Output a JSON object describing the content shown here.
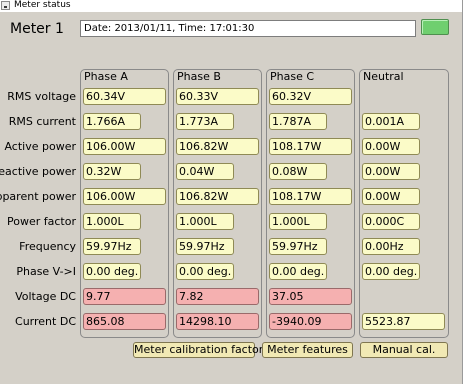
{
  "window": {
    "title": "Meter status"
  },
  "header": {
    "meter_label": "Meter 1",
    "datetime": "Date: 2013/01/11, Time: 17:01:30",
    "status_color": "#6fcf6f"
  },
  "table": {
    "columns": [
      "Phase A",
      "Phase B",
      "Phase C",
      "Neutral"
    ],
    "rows": [
      {
        "label": "RMS voltage",
        "values": [
          "60.34V",
          "60.33V",
          "60.32V",
          ""
        ]
      },
      {
        "label": "RMS current",
        "values": [
          "1.766A",
          "1.773A",
          "1.787A",
          "0.001A"
        ]
      },
      {
        "label": "Active power",
        "values": [
          "106.00W",
          "106.82W",
          "108.17W",
          "0.00W"
        ]
      },
      {
        "label": "Reactive power",
        "values": [
          "0.32W",
          "0.04W",
          "0.08W",
          "0.00W"
        ]
      },
      {
        "label": "Apparent power",
        "values": [
          "106.00W",
          "106.82W",
          "108.17W",
          "0.00W"
        ]
      },
      {
        "label": "Power factor",
        "values": [
          "1.000L",
          "1.000L",
          "1.000L",
          "0.000C"
        ]
      },
      {
        "label": "Frequency",
        "values": [
          "59.97Hz",
          "59.97Hz",
          "59.97Hz",
          "0.00Hz"
        ]
      },
      {
        "label": "Phase V->I",
        "values": [
          "0.00 deg.",
          "0.00 deg.",
          "0.00 deg.",
          "0.00 deg."
        ]
      },
      {
        "label": "Voltage DC",
        "values": [
          "9.77",
          "7.82",
          "37.05",
          ""
        ]
      },
      {
        "label": "Current DC",
        "values": [
          "865.08",
          "14298.10",
          "-3940.09",
          "5523.87"
        ]
      }
    ]
  },
  "buttons": {
    "calibration_factors": "Meter calibration factors",
    "features": "Meter features",
    "manual_cal": "Manual cal."
  },
  "colors": {
    "value_field": "#fbfbc8",
    "dc_alert_field": "#f5b0b0",
    "panel_background": "#d4d0c8"
  }
}
